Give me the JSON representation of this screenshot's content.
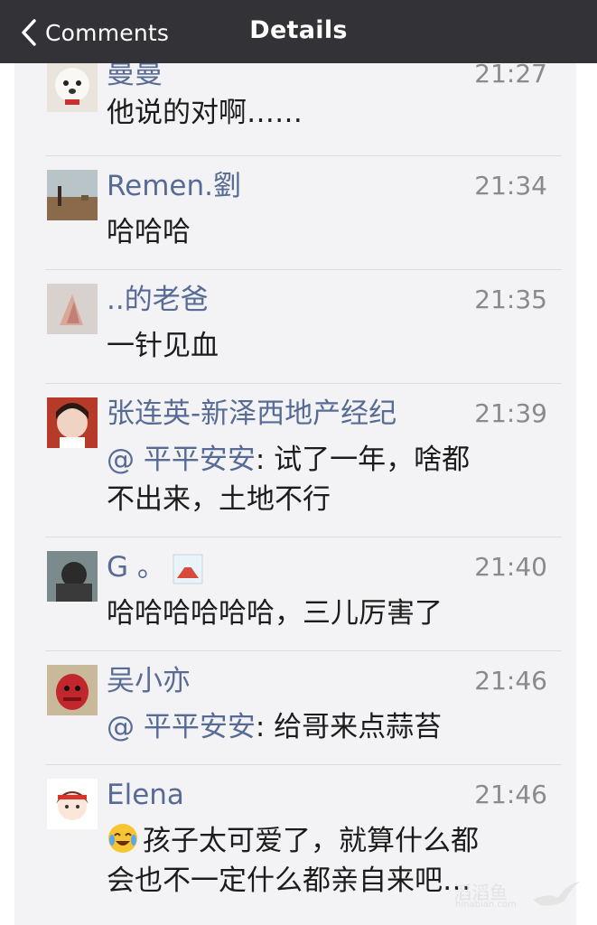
{
  "nav": {
    "back_label": "Comments",
    "title": "Details"
  },
  "comments": [
    {
      "name": "曼曼",
      "time": "21:27",
      "text": "他说的对啊……"
    },
    {
      "name": "Remen.劉",
      "time": "21:34",
      "text": "哈哈哈"
    },
    {
      "name": "..的老爸",
      "time": "21:35",
      "text": "一针见血"
    },
    {
      "name": "张连英-新泽西地产经纪",
      "time": "21:39",
      "mention": "@ 平平安安",
      "text": ": 试了一年，啥都",
      "text2": "不出来，土地不行"
    },
    {
      "name": "G 。",
      "time": "21:40",
      "text": "哈哈哈哈哈哈，三儿厉害了"
    },
    {
      "name": "吴小亦",
      "time": "21:46",
      "mention": "@ 平平安安",
      "text": ": 给哥来点蒜苔"
    },
    {
      "name": "Elena",
      "time": "21:46",
      "text": "孩子太可爱了，就算什么都",
      "text2": "会也不一定什么都亲自来吧…"
    }
  ],
  "watermark": {
    "text": "滔滔鱼",
    "sub": "hinabian.com"
  },
  "icons": {
    "back": "chevron-left-icon",
    "emoji": "crying-laughing-emoji-icon",
    "inline": "mountain-image-icon"
  }
}
